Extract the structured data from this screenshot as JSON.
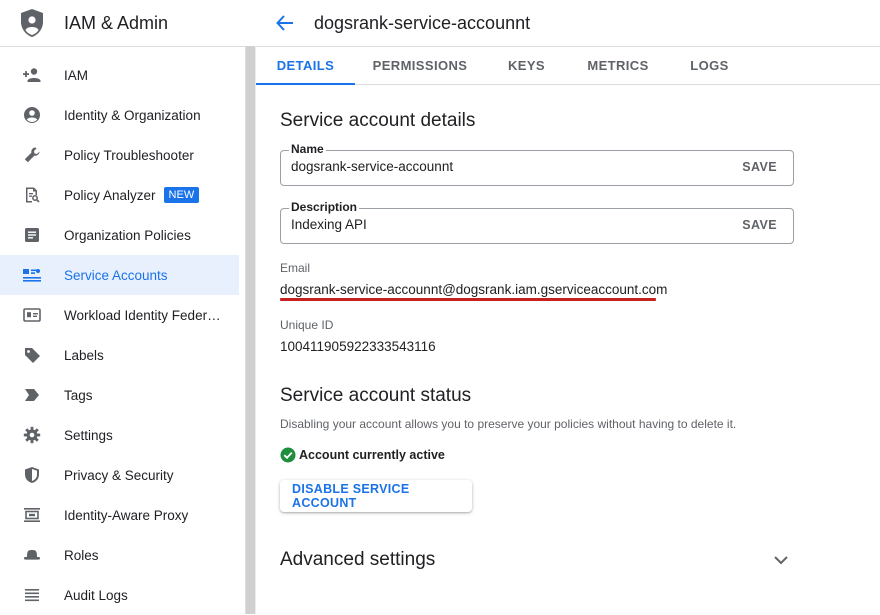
{
  "app": {
    "title": "IAM & Admin"
  },
  "sidebar": {
    "items": [
      {
        "label": "IAM",
        "icon": "person-add-icon"
      },
      {
        "label": "Identity & Organization",
        "icon": "account-circle-icon"
      },
      {
        "label": "Policy Troubleshooter",
        "icon": "wrench-icon"
      },
      {
        "label": "Policy Analyzer",
        "icon": "report-search-icon",
        "badge": "NEW"
      },
      {
        "label": "Organization Policies",
        "icon": "article-icon"
      },
      {
        "label": "Service Accounts",
        "icon": "service-account-icon",
        "active": true
      },
      {
        "label": "Workload Identity Federat…",
        "icon": "id-card-icon"
      },
      {
        "label": "Labels",
        "icon": "tag-icon"
      },
      {
        "label": "Tags",
        "icon": "label-arrow-icon"
      },
      {
        "label": "Settings",
        "icon": "gear-icon"
      },
      {
        "label": "Privacy & Security",
        "icon": "shield-icon"
      },
      {
        "label": "Identity-Aware Proxy",
        "icon": "proxy-icon"
      },
      {
        "label": "Roles",
        "icon": "hat-icon"
      },
      {
        "label": "Audit Logs",
        "icon": "list-icon"
      }
    ]
  },
  "header": {
    "page_title": "dogsrank-service-accounnt"
  },
  "tabs": [
    {
      "label": "DETAILS",
      "active": true
    },
    {
      "label": "PERMISSIONS"
    },
    {
      "label": "KEYS"
    },
    {
      "label": "METRICS"
    },
    {
      "label": "LOGS"
    }
  ],
  "details": {
    "section_title": "Service account details",
    "name": {
      "label": "Name",
      "value": "dogsrank-service-accounnt",
      "save": "SAVE"
    },
    "description": {
      "label": "Description",
      "value": "Indexing API",
      "save": "SAVE"
    },
    "email": {
      "label": "Email",
      "value": "dogsrank-service-accounnt@dogsrank.iam.gserviceaccount.com"
    },
    "unique_id": {
      "label": "Unique ID",
      "value": "100411905922333543116"
    }
  },
  "status": {
    "section_title": "Service account status",
    "description": "Disabling your account allows you to preserve your policies without having to delete it.",
    "state": "Account currently active",
    "disable_button": "DISABLE SERVICE ACCOUNT"
  },
  "advanced": {
    "title": "Advanced settings"
  },
  "colors": {
    "accent": "#1a73e8",
    "active_bg": "#e8f0fe",
    "success": "#1e8e3e",
    "highlight": "#c5221f"
  }
}
